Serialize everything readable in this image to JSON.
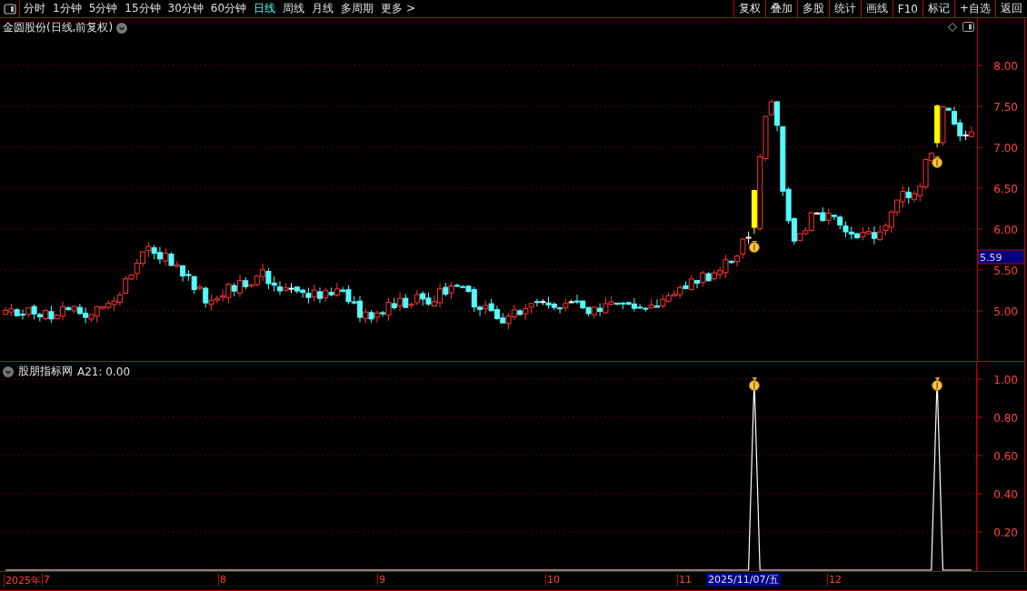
{
  "toolbar": {
    "periods": [
      {
        "label": "分时",
        "selected": false
      },
      {
        "label": "1分钟",
        "selected": false
      },
      {
        "label": "5分钟",
        "selected": false
      },
      {
        "label": "15分钟",
        "selected": false
      },
      {
        "label": "30分钟",
        "selected": false
      },
      {
        "label": "60分钟",
        "selected": false
      },
      {
        "label": "日线",
        "selected": true
      },
      {
        "label": "周线",
        "selected": false
      },
      {
        "label": "月线",
        "selected": false
      },
      {
        "label": "多周期",
        "selected": false
      },
      {
        "label": "更多 >",
        "selected": false
      }
    ],
    "buttons": [
      "复权",
      "叠加",
      "多股",
      "统计",
      "画线",
      "F10",
      "标记",
      "+自选",
      "返回"
    ]
  },
  "price_chart": {
    "title": "金圆股份(日线,前复权)",
    "price_labels": [
      "8.00",
      "7.50",
      "7.00",
      "6.50",
      "6.00",
      "5.50",
      "5.00"
    ],
    "current_price": "5.59"
  },
  "indicator": {
    "name": "股朋指标网",
    "reading": ": 0.00",
    "chart_data": {
      "type": "line",
      "grid": true,
      "ylim": [
        0,
        1.05
      ],
      "yticks": [
        {
          "value": 0.2,
          "label": "0.20"
        },
        {
          "value": 0.4,
          "label": "0.40"
        },
        {
          "value": 0.6,
          "label": "0.60"
        },
        {
          "value": 0.8,
          "label": "0.80"
        },
        {
          "value": 1,
          "label": "1.00"
        }
      ],
      "series": [
        {
          "name": "A21",
          "color": "#ffffff",
          "values": [
            0,
            0,
            0,
            0,
            0,
            0,
            0,
            0,
            0,
            0,
            0,
            0,
            0,
            0,
            0,
            0,
            0,
            0,
            0,
            0,
            0,
            0,
            0,
            0,
            0,
            0,
            0,
            0,
            0,
            0,
            0,
            0,
            0,
            0,
            0,
            0,
            0,
            0,
            0,
            0,
            0,
            0,
            0,
            0,
            0,
            0,
            0,
            0,
            0,
            0,
            0,
            0,
            0,
            0,
            0,
            0,
            0,
            0,
            0,
            0,
            0,
            0,
            0,
            0,
            0,
            0,
            0,
            0,
            0,
            0,
            0,
            0,
            0,
            0,
            0,
            0,
            0,
            0,
            0,
            0,
            0,
            0,
            0,
            0,
            0,
            0,
            0,
            0,
            0,
            0,
            0,
            0,
            0,
            0,
            0,
            0,
            0,
            0,
            0,
            0,
            0,
            0,
            0,
            0,
            0,
            0,
            0,
            0,
            0,
            0,
            0,
            0,
            0,
            0,
            0,
            0,
            0,
            0,
            0,
            0,
            0,
            0,
            0,
            0,
            0,
            0,
            0,
            0,
            0,
            0,
            0,
            1,
            0,
            0,
            0,
            0,
            0,
            0,
            0,
            0,
            0,
            0,
            0,
            0,
            0,
            0,
            0,
            0,
            0,
            0,
            0,
            0,
            0,
            0,
            0,
            0,
            0,
            0,
            0,
            0,
            0,
            0,
            0,
            1,
            0,
            0,
            0,
            0,
            0,
            0
          ]
        }
      ]
    }
  },
  "date_axis": {
    "labels": [
      "2025年",
      "7",
      "8",
      "9",
      "10",
      "11",
      "12"
    ],
    "cursor_date": "2025/11/07/五"
  }
}
